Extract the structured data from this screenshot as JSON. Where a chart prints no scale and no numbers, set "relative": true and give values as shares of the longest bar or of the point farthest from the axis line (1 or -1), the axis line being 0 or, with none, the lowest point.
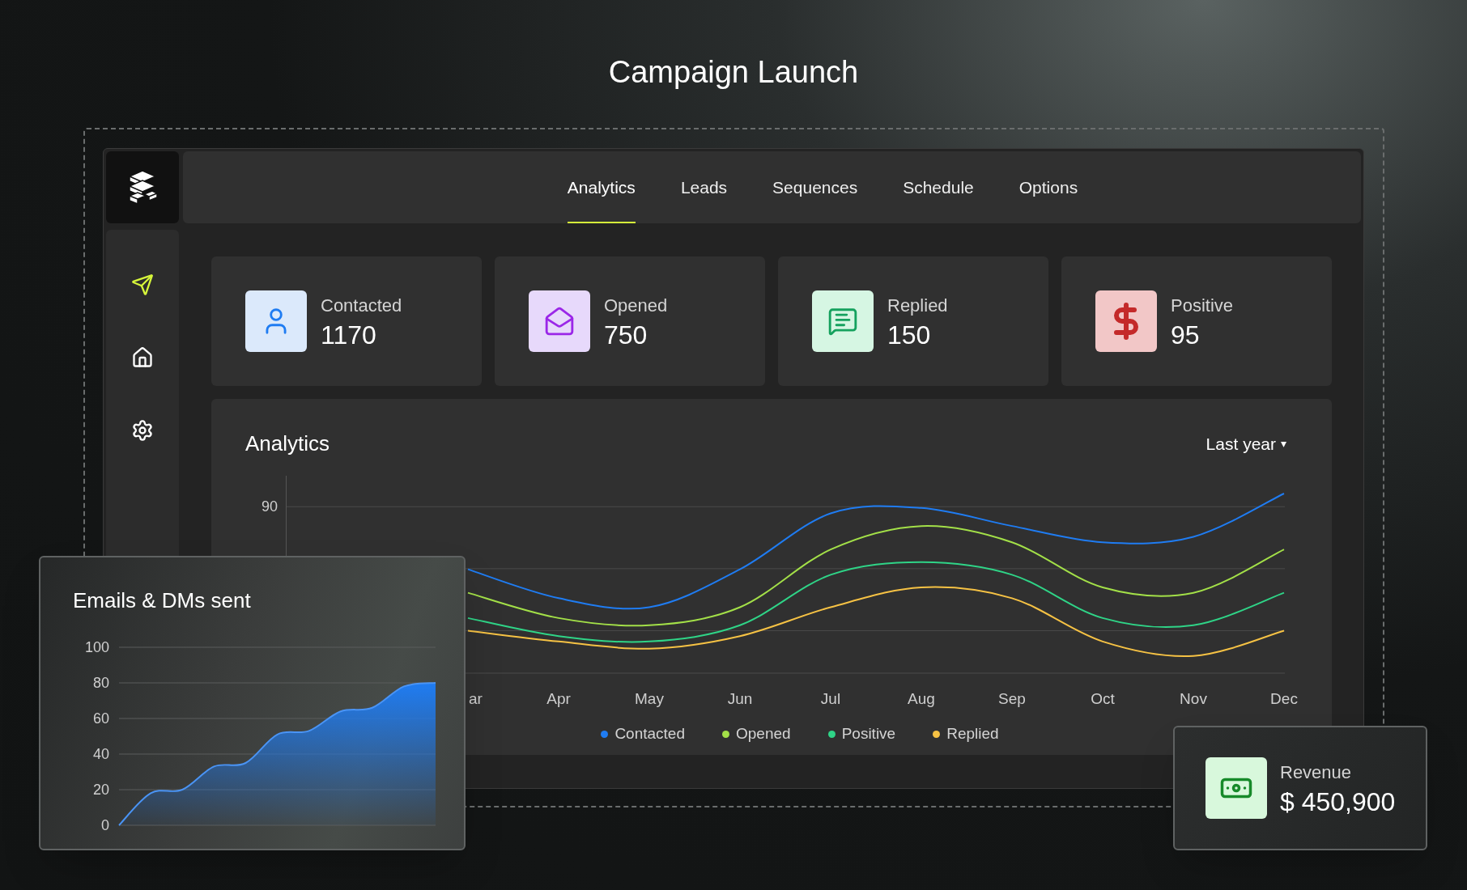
{
  "title": "Campaign Launch",
  "nav": {
    "tabs": [
      {
        "label": "Analytics",
        "selected": true
      },
      {
        "label": "Leads",
        "selected": false
      },
      {
        "label": "Sequences",
        "selected": false
      },
      {
        "label": "Schedule",
        "selected": false
      },
      {
        "label": "Options",
        "selected": false
      }
    ]
  },
  "sidebar": {
    "items": [
      {
        "kind": "send",
        "selected": true
      },
      {
        "kind": "home",
        "selected": false
      },
      {
        "kind": "settings",
        "selected": false
      }
    ]
  },
  "stats": [
    {
      "kind": "contacted",
      "label": "Contacted",
      "value": "1170"
    },
    {
      "kind": "opened",
      "label": "Opened",
      "value": "750"
    },
    {
      "kind": "replied",
      "label": "Replied",
      "value": "150"
    },
    {
      "kind": "positive",
      "label": "Positive",
      "value": "95"
    }
  ],
  "analytics": {
    "title": "Analytics",
    "range": "Last year",
    "range_caret": "▾",
    "y_axis_label": "90",
    "chart_data": {
      "type": "line",
      "relative": true,
      "categories": [
        "ar",
        "Apr",
        "May",
        "Jun",
        "Jul",
        "Aug",
        "Sep",
        "Oct",
        "Nov",
        "Dec"
      ],
      "series": [
        {
          "name": "Contacted",
          "color": "#1f7cf2",
          "values": [
            0.58,
            0.42,
            0.37,
            0.58,
            0.89,
            0.92,
            0.82,
            0.73,
            0.76,
            1
          ]
        },
        {
          "name": "Opened",
          "color": "#a3e048",
          "values": [
            0.45,
            0.31,
            0.27,
            0.37,
            0.69,
            0.82,
            0.73,
            0.48,
            0.45,
            0.69
          ]
        },
        {
          "name": "Positive",
          "color": "#2fd487",
          "values": [
            0.31,
            0.21,
            0.18,
            0.27,
            0.55,
            0.62,
            0.55,
            0.31,
            0.27,
            0.45
          ]
        },
        {
          "name": "Replied",
          "color": "#f6c244",
          "values": [
            0.24,
            0.18,
            0.14,
            0.21,
            0.37,
            0.48,
            0.42,
            0.18,
            0.1,
            0.24
          ]
        }
      ]
    }
  },
  "emails_card": {
    "chart_data": {
      "type": "area",
      "title": "Emails & DMs sent",
      "ylim": [
        0,
        100
      ],
      "grid": true,
      "yticks": [
        {
          "value": 0,
          "label": "0"
        },
        {
          "value": 20,
          "label": "20"
        },
        {
          "value": 40,
          "label": "40"
        },
        {
          "value": 60,
          "label": "60"
        },
        {
          "value": 80,
          "label": "80"
        },
        {
          "value": 100,
          "label": "100"
        }
      ],
      "series": [
        {
          "color": "#1f7cf2",
          "values": [
            0,
            18,
            20,
            33,
            35,
            51,
            53,
            64,
            66,
            78,
            80
          ]
        }
      ]
    }
  },
  "revenue": {
    "label": "Revenue",
    "value": "$ 450,900"
  }
}
